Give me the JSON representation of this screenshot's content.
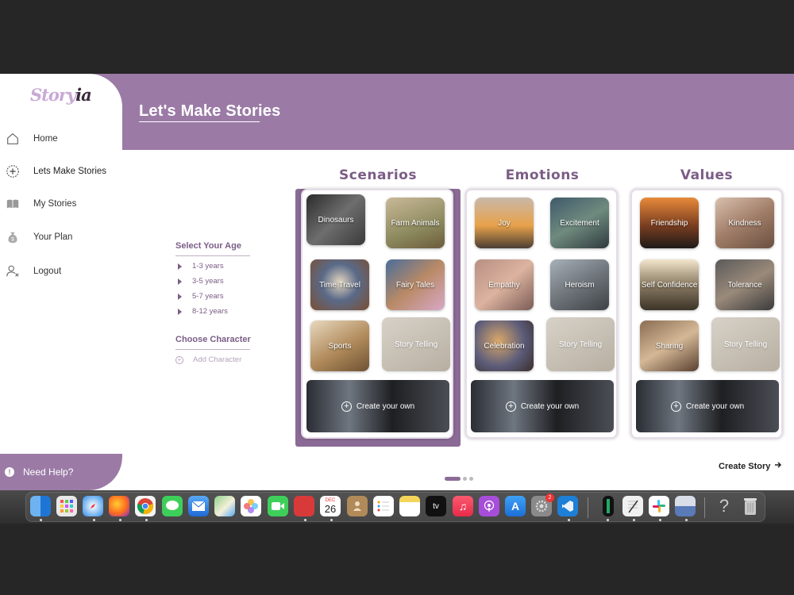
{
  "app": {
    "logo_text_a": "Story",
    "logo_text_b": "ia"
  },
  "header": {
    "title": "Let's Make Stories"
  },
  "sidebar": {
    "items": [
      {
        "label": "Home",
        "icon": "home-icon"
      },
      {
        "label": "Lets Make Stories",
        "icon": "plus-circle-icon"
      },
      {
        "label": "My Stories",
        "icon": "book-icon"
      },
      {
        "label": "Your Plan",
        "icon": "money-bag-icon"
      },
      {
        "label": "Logout",
        "icon": "user-x-icon"
      }
    ],
    "help": "Need Help?"
  },
  "filters": {
    "age_title": "Select Your Age",
    "ages": [
      "1-3 years",
      "3-5 years",
      "5-7 years",
      "8-12 years"
    ],
    "character_title": "Choose Character",
    "add_character": "Add Character"
  },
  "columns": [
    {
      "title": "Scenarios",
      "tiles": [
        "Dinosaurs",
        "Farm Animals",
        "Time Travel",
        "Fairy Tales",
        "Sports",
        "Story Telling"
      ],
      "create": "Create your own"
    },
    {
      "title": "Emotions",
      "tiles": [
        "Joy",
        "Excitement",
        "Empathy",
        "Heroism",
        "Celebration",
        "Story Telling"
      ],
      "create": "Create your own"
    },
    {
      "title": "Values",
      "tiles": [
        "Friendship",
        "Kindness",
        "Self Confidence",
        "Tolerance",
        "Sharing",
        "Story Telling"
      ],
      "create": "Create your own"
    }
  ],
  "actions": {
    "create_story": "Create Story"
  },
  "pager": {
    "count": 3,
    "active": 1
  },
  "dock": {
    "calendar_month": "DEC",
    "calendar_day": "26",
    "settings_badge": "2",
    "tv_label": "tv"
  }
}
